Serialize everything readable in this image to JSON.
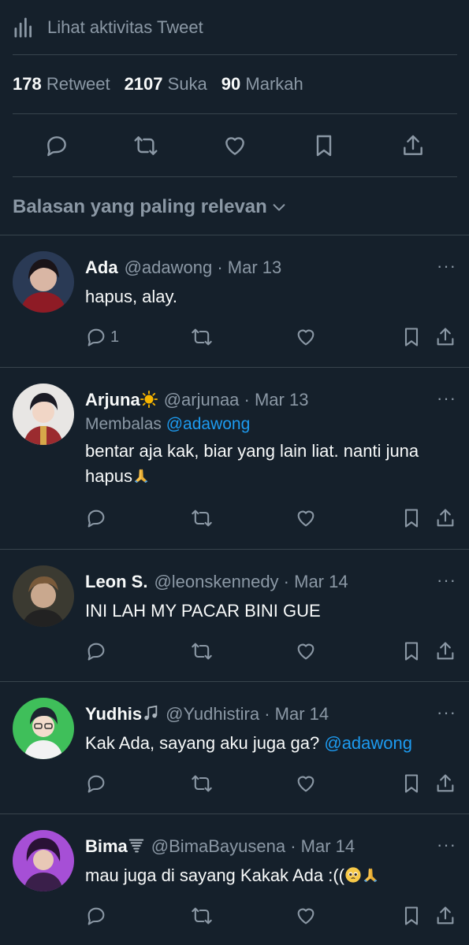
{
  "activity": {
    "label": "Lihat aktivitas Tweet",
    "icon": "bar-chart-icon"
  },
  "stats": [
    {
      "count": "178",
      "label": "Retweet"
    },
    {
      "count": "2107",
      "label": "Suka"
    },
    {
      "count": "90",
      "label": "Markah"
    }
  ],
  "actions": {
    "icons": [
      "reply-icon",
      "retweet-icon",
      "like-icon",
      "bookmark-icon",
      "share-icon"
    ]
  },
  "sort": {
    "label": "Balasan yang paling relevan",
    "icon": "chevron-down-icon"
  },
  "replies": [
    {
      "name": "Ada",
      "handle": "@adawong",
      "date": "Mar 13",
      "replying_prefix": "",
      "replying_to": "",
      "text": "hapus, alay.",
      "text_mention": "",
      "reply_count": "1",
      "more": "···"
    },
    {
      "name": "Arjuna",
      "handle": "@arjunaa",
      "date": "Mar 13",
      "replying_prefix": "Membalas",
      "replying_to": "@adawong",
      "text": "bentar aja kak, biar yang lain liat. nanti juna hapus",
      "text_mention": "",
      "reply_count": "",
      "more": "···"
    },
    {
      "name": "Leon S.",
      "handle": "@leonskennedy",
      "date": "Mar 14",
      "replying_prefix": "",
      "replying_to": "",
      "text": "INI LAH MY PACAR BINI GUE",
      "text_mention": "",
      "reply_count": "",
      "more": "···"
    },
    {
      "name": "Yudhis",
      "handle": "@Yudhistira",
      "date": "Mar 14",
      "replying_prefix": "",
      "replying_to": "",
      "text": "Kak Ada, sayang aku juga ga?",
      "text_mention": "@adawong",
      "reply_count": "",
      "more": "···"
    },
    {
      "name": "Bima",
      "handle": "@BimaBayusena",
      "date": "Mar 14",
      "replying_prefix": "",
      "replying_to": "",
      "text": "mau juga di sayang Kakak Ada :((",
      "text_mention": "",
      "reply_count": "",
      "more": "···"
    }
  ],
  "colors": {
    "background": "#15202b",
    "border": "#38444d",
    "secondary": "#8b98a5",
    "mention": "#1d9bf0"
  }
}
